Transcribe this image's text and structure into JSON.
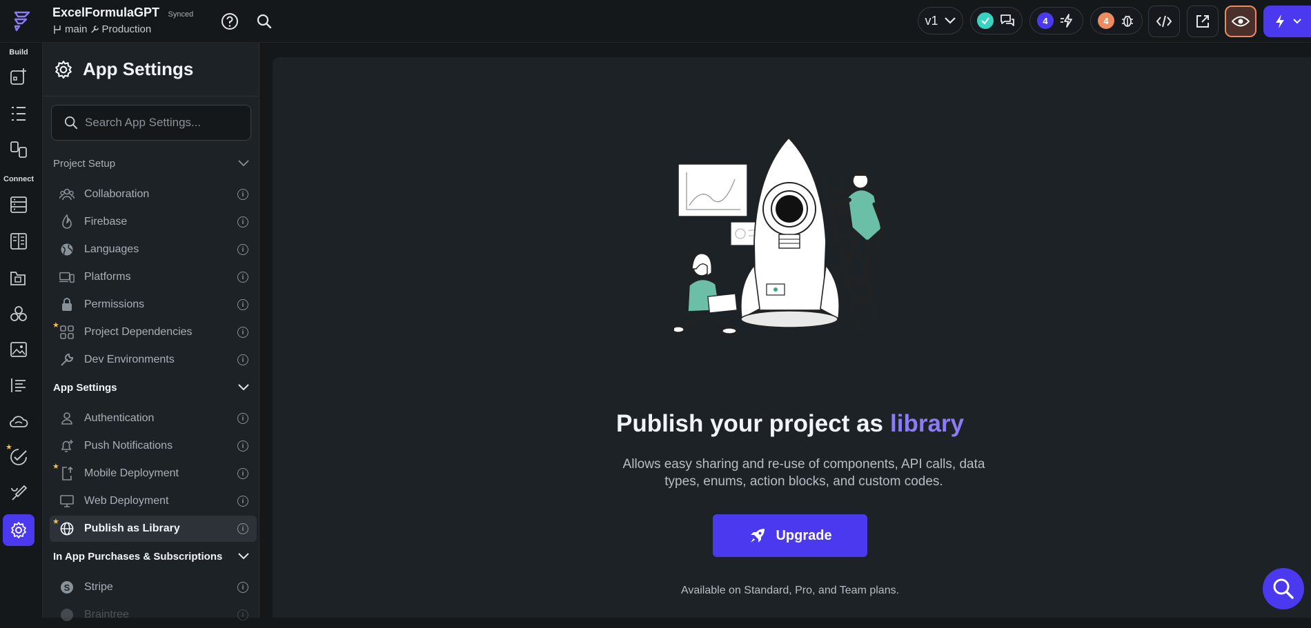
{
  "header": {
    "project_name": "ExcelFormulaGPT",
    "sync_status": "Synced",
    "branch": "main",
    "environment": "Production",
    "version": "v1",
    "actions_count": "4",
    "issues_count": "4"
  },
  "rail": {
    "build_label": "Build",
    "connect_label": "Connect"
  },
  "panel": {
    "title": "App Settings",
    "search_placeholder": "Search App Settings...",
    "sections": {
      "project_setup": "Project Setup",
      "app_settings": "App Settings",
      "iap": "In App Purchases & Subscriptions"
    },
    "items": {
      "collaboration": "Collaboration",
      "firebase": "Firebase",
      "languages": "Languages",
      "platforms": "Platforms",
      "permissions": "Permissions",
      "project_dependencies": "Project Dependencies",
      "dev_environments": "Dev Environments",
      "authentication": "Authentication",
      "push_notifications": "Push Notifications",
      "mobile_deployment": "Mobile Deployment",
      "web_deployment": "Web Deployment",
      "publish_as_library": "Publish as Library",
      "stripe": "Stripe",
      "braintree": "Braintree"
    }
  },
  "main": {
    "title_prefix": "Publish your project as",
    "title_accent": "library",
    "description": "Allows easy sharing and re-use of components, API calls, data types, enums, action blocks, and custom codes.",
    "upgrade_label": "Upgrade",
    "plans_note": "Available on Standard, Pro, and Team plans."
  },
  "colors": {
    "accent": "#4b39ef",
    "accent_text": "#8b7cf6",
    "success": "#39d2c0",
    "warning": "#ee8b60"
  }
}
